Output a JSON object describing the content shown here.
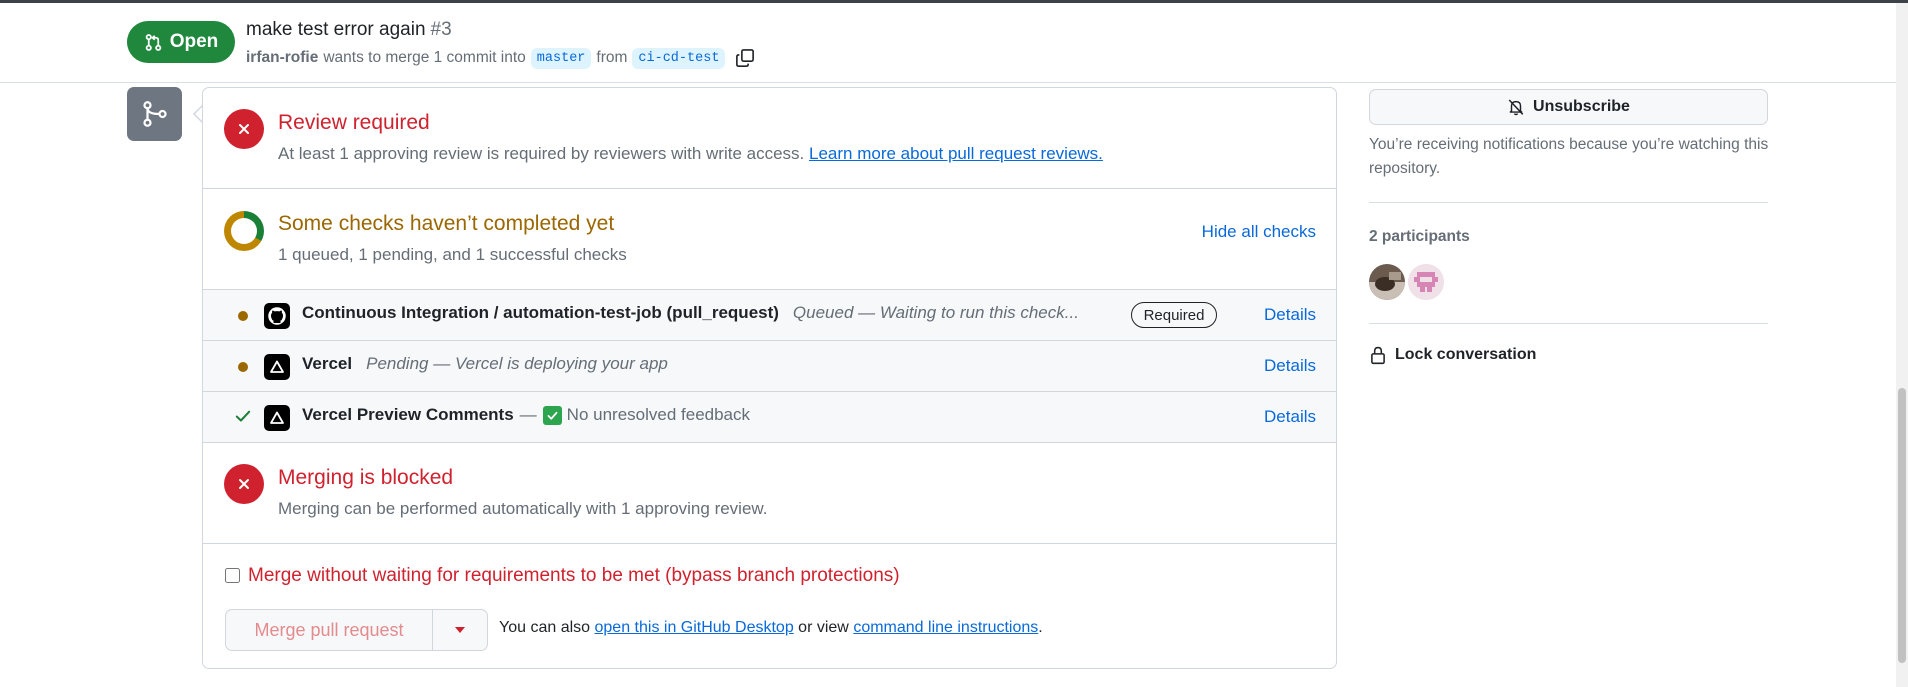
{
  "header": {
    "state": "Open",
    "title": "make test error again",
    "number": "#3",
    "author": "irfan-rofie",
    "merge_text": "wants to merge 1 commit into",
    "base_branch": "master",
    "from_text": "from",
    "head_branch": "ci-cd-test"
  },
  "review": {
    "title": "Review required",
    "subtitle": "At least 1 approving review is required by reviewers with write access.",
    "link": "Learn more about pull request reviews."
  },
  "checks": {
    "title": "Some checks haven’t completed yet",
    "subtitle": "1 queued, 1 pending, and 1 successful checks",
    "toggle": "Hide all checks",
    "items": [
      {
        "name": "Continuous Integration / automation-test-job (pull_request)",
        "description": "Queued — Waiting to run this check...",
        "badge": "Required",
        "details": "Details",
        "status": "queued"
      },
      {
        "name": "Vercel",
        "description": "Pending — Vercel is deploying your app",
        "details": "Details",
        "status": "pending"
      },
      {
        "name": "Vercel Preview Comments",
        "separator": "—",
        "description": "No unresolved feedback",
        "details": "Details",
        "status": "success"
      }
    ]
  },
  "blocked": {
    "title": "Merging is blocked",
    "subtitle": "Merging can be performed automatically with 1 approving review."
  },
  "actions": {
    "bypass_label": "Merge without waiting for requirements to be met (bypass branch protections)",
    "bypass_checked": false,
    "merge_button": "Merge pull request",
    "also_prefix": "You can also",
    "desktop_link": "open this in GitHub Desktop",
    "or_view": "or view",
    "cli_link": "command line instructions",
    "period": "."
  },
  "sidebar": {
    "unsubscribe": "Unsubscribe",
    "notification_text": "You’re receiving notifications because you’re watching this repository.",
    "participants_title": "2 participants",
    "lock": "Lock conversation"
  },
  "colors": {
    "open_green": "#1f883d",
    "danger_red": "#cf222e",
    "attention_amber": "#9a6700",
    "link_blue": "#0969da"
  }
}
